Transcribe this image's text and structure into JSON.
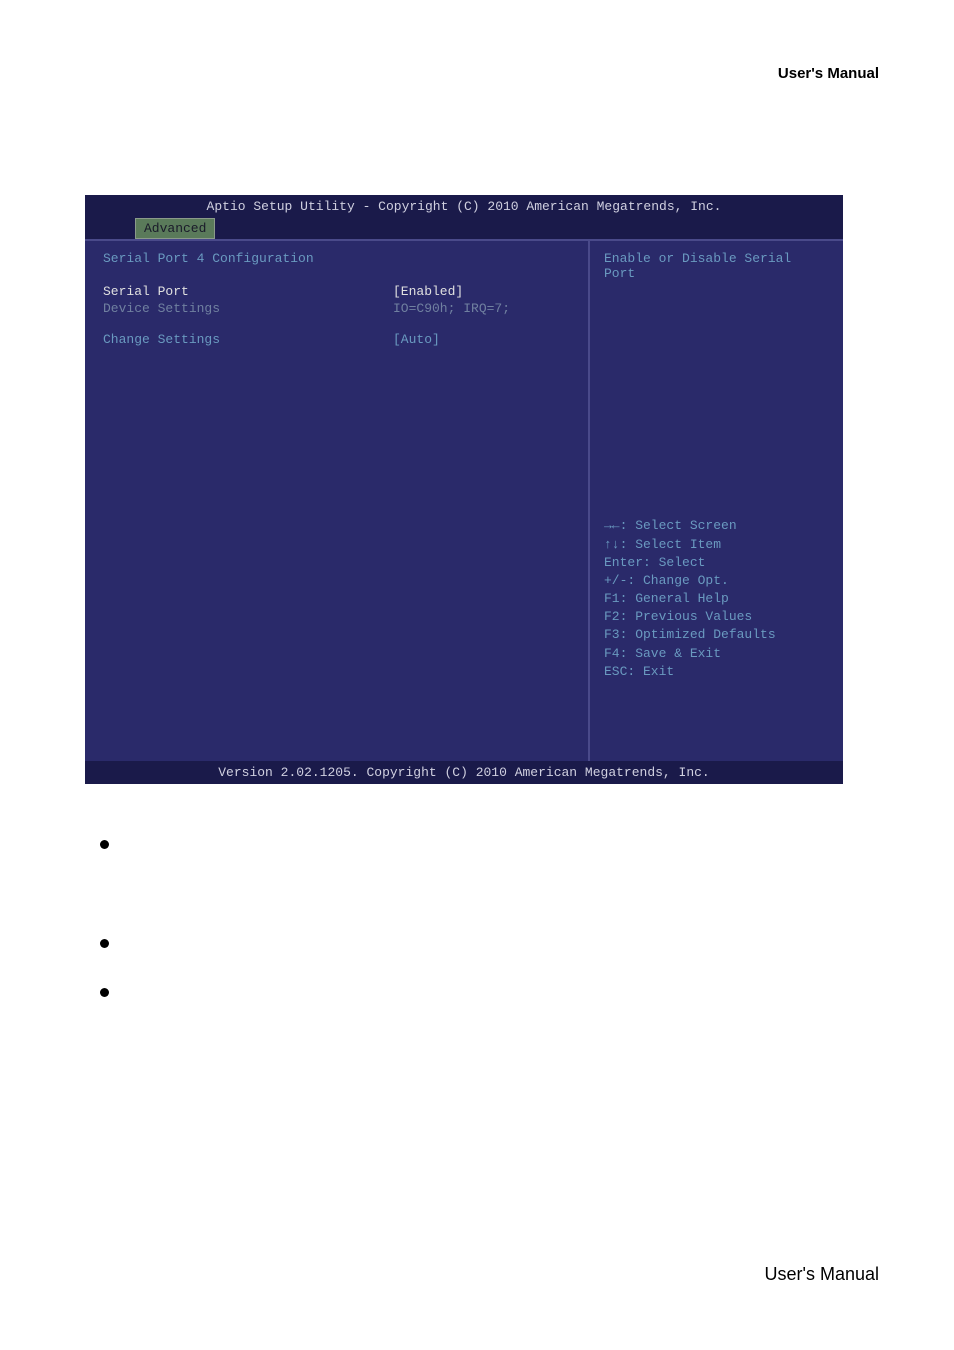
{
  "header": {
    "title": "User's Manual"
  },
  "bios": {
    "titlebar": "Aptio Setup Utility - Copyright (C) 2010 American Megatrends, Inc.",
    "tab": "Advanced",
    "section_title": "Serial Port 4 Configuration",
    "rows": {
      "serial_port": {
        "label": "Serial Port",
        "value": "[Enabled]"
      },
      "device_settings": {
        "label": "Device Settings",
        "value": "IO=C90h; IRQ=7;"
      },
      "change_settings": {
        "label": "Change Settings",
        "value": "[Auto]"
      }
    },
    "help_top": "Enable or Disable Serial Port",
    "help_keys": [
      "→←: Select Screen",
      "↑↓: Select Item",
      "Enter: Select",
      "+/-: Change Opt.",
      "F1: General Help",
      "F2: Previous Values",
      "F3: Optimized Defaults",
      "F4: Save & Exit",
      "ESC: Exit"
    ],
    "footer": "Version 2.02.1205. Copyright (C) 2010 American Megatrends, Inc."
  },
  "page_footer": "User's Manual"
}
